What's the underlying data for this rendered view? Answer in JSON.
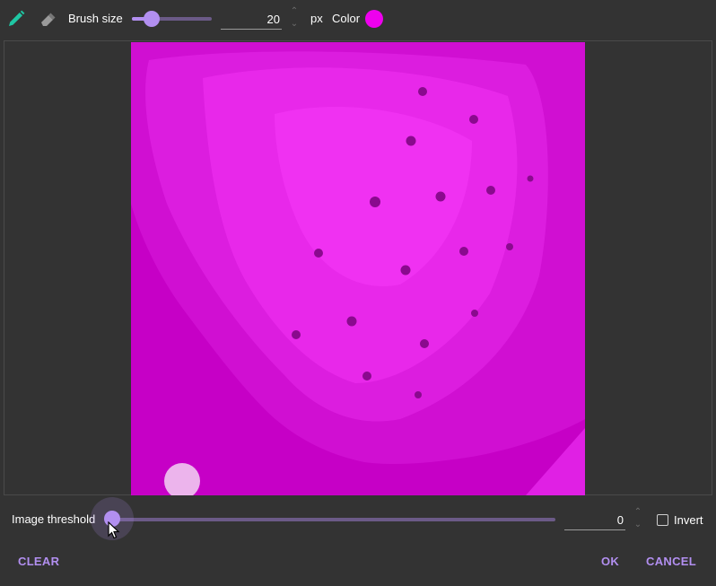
{
  "toolbar": {
    "pencil_icon": "pencil-icon",
    "eraser_icon": "eraser-icon",
    "brush_size_label": "Brush size",
    "brush_size_value": "20",
    "brush_size_slider_fraction": 0.25,
    "unit_label": "px",
    "color_label": "Color",
    "color_value": "#ee00ee"
  },
  "canvas": {
    "image_description_color": "#c600c6",
    "cursor_preview_color": "#ecb4ec"
  },
  "threshold": {
    "label": "Image threshold",
    "value": "0",
    "slider_fraction": 0.0
  },
  "invert": {
    "label": "Invert",
    "checked": false
  },
  "actions": {
    "clear_label": "CLEAR",
    "ok_label": "OK",
    "cancel_label": "CANCEL"
  },
  "colors": {
    "accent": "#b28ff0",
    "track": "#6b5a87",
    "background": "#333333"
  }
}
